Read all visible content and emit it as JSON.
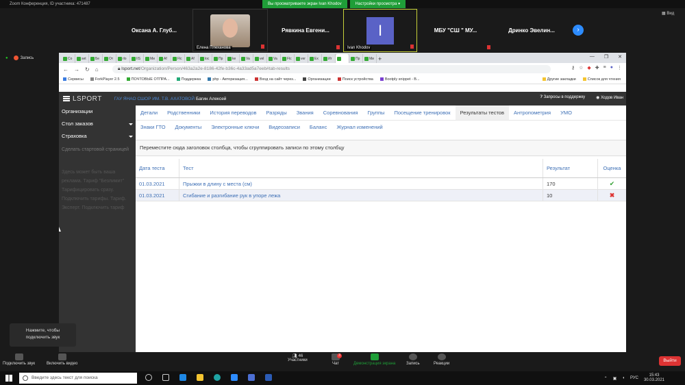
{
  "zoom": {
    "title": "Zoom Конференция, ID участника: 471487",
    "sharing_label": "Вы просматриваете экран Ivan Khodov",
    "view_options_label": "Настройки просмотра",
    "view_label": "Вид",
    "record_label": "Запись",
    "participants": [
      {
        "name": "Оксана А. Глуб..."
      },
      {
        "name": "Елена Плеханова"
      },
      {
        "name": "Рявкина Евгени..."
      },
      {
        "name": "Ivan Khodov",
        "initial": "I"
      },
      {
        "name": "МБУ \"СШ \" МУ..."
      },
      {
        "name": "Дринко Эвелин..."
      }
    ],
    "tooltip": [
      "Нажмите, чтобы",
      "подключить звук"
    ],
    "toolbar": {
      "audio": "Подключить звук",
      "video": "Включить видео",
      "participants": "Участники",
      "participants_count": "46",
      "chat": "Чат",
      "chat_badge": "3",
      "share": "Демонстрация экрана",
      "record": "Запись",
      "reactions": "Реакции",
      "exit": "Выйти"
    }
  },
  "browser": {
    "tabs": [
      "Со",
      "set",
      "Бе",
      "От",
      "rlo",
      "IIS",
      "Ми",
      "Af",
      "Flc",
      "Af",
      "loc",
      "Пр",
      "ke",
      "Va",
      "vel",
      "Va",
      "Flc",
      "ver",
      "Ex",
      "Иг",
      "",
      "Пр",
      "Ми"
    ],
    "url_host": "lsport.net",
    "url_path": "/Organization/Person/463a2a2e-8186-42fe-b36c-4a33ad5a7eeb#tab-results",
    "bookmarks": [
      "Сервисы",
      "ForkPlayer 2.5",
      "ПОЧТОВЫЕ ОТПРА...",
      "Поддержка",
      "php - Авторизация...",
      "Вход на сайт через...",
      "Организации",
      "Поиск устройства",
      "Bootply snippet - B..."
    ],
    "bookmarks_right": [
      "Другие закладки",
      "Список для чтения"
    ]
  },
  "app": {
    "logo": "LSPORT",
    "org": "ГАУ ЯНАО СШОР ИМ. Т.В. АХАТОВОЙ",
    "person": "Багин Алексей",
    "support": "Запросы в поддержку",
    "user": "Ходов Иван",
    "sidebar": {
      "items": [
        "Организации",
        "Стол заказов",
        "Страховка"
      ],
      "start_page": "Сделать стартовой страницей",
      "notice": "Здесь может быть ваша реклама. Тариф \"Безлимит\" Тарифицировать сразу. Подключить тарифы. Тариф. Эксперт. Подключить тариф"
    },
    "tabs_row1": [
      "Детали",
      "Родственники",
      "История переводов",
      "Разряды",
      "Звания",
      "Соревнования",
      "Группы",
      "Посещение тренировок",
      "Результаты тестов",
      "Антропометрия",
      "УМО"
    ],
    "tabs_row2": [
      "Знаки ГТО",
      "Документы",
      "Электронные ключи",
      "Видеозаписи",
      "Баланс",
      "Журнал изменений"
    ],
    "active_tab": "Результаты тестов",
    "group_hint": "Переместите сюда заголовок столбца, чтобы сгруппировать записи по этому столбцу",
    "table": {
      "headers": [
        "Дата теста",
        "Тест",
        "Результат",
        "Оценка"
      ],
      "rows": [
        {
          "date": "01.03.2021",
          "test": "Прыжки в длину с места (см)",
          "result": "170",
          "mark": "✔"
        },
        {
          "date": "01.03.2021",
          "test": "Сгибание и разгибание рук в упоре лежа",
          "result": "10",
          "mark": "✖"
        }
      ]
    }
  },
  "taskbar": {
    "search_placeholder": "Введите здесь текст для поиска",
    "lang": "РУС",
    "time": "15:43",
    "date": "30.03.2021"
  }
}
